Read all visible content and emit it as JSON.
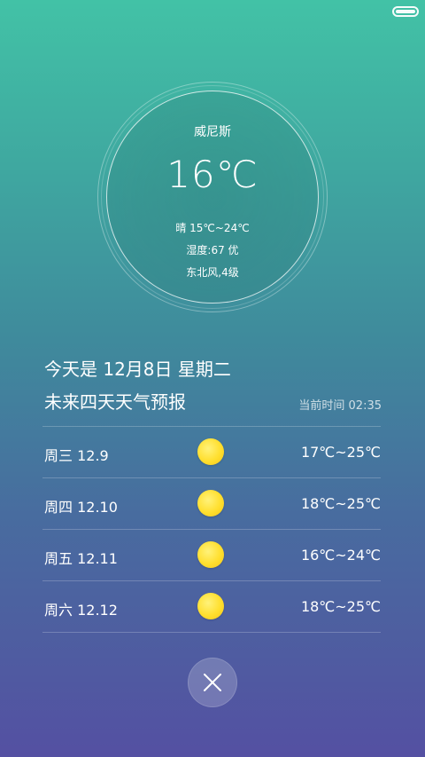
{
  "status_bar": {
    "battery_icon": "battery-full-icon"
  },
  "current": {
    "city": "威尼斯",
    "temperature": "16℃",
    "condition_range": "晴  15℃~24℃",
    "humidity": "湿度:67 优",
    "wind": "东北风,4级"
  },
  "today": {
    "label": "今天是  12月8日 星期二"
  },
  "forecast": {
    "title": "未来四天天气预报",
    "current_time": "当前时间 02:35",
    "days": [
      {
        "day": "周三 12.9",
        "icon": "sun-icon",
        "range": "17℃~25℃"
      },
      {
        "day": "周四 12.10",
        "icon": "sun-icon",
        "range": "18℃~25℃"
      },
      {
        "day": "周五 12.11",
        "icon": "sun-icon",
        "range": "16℃~24℃"
      },
      {
        "day": "周六 12.12",
        "icon": "sun-icon",
        "range": "18℃~25℃"
      }
    ]
  },
  "close": {
    "icon": "close-icon"
  },
  "colors": {
    "gradient_top": "#42c2a6",
    "gradient_bottom": "#5450a2",
    "sun": "#ffdf2e"
  }
}
